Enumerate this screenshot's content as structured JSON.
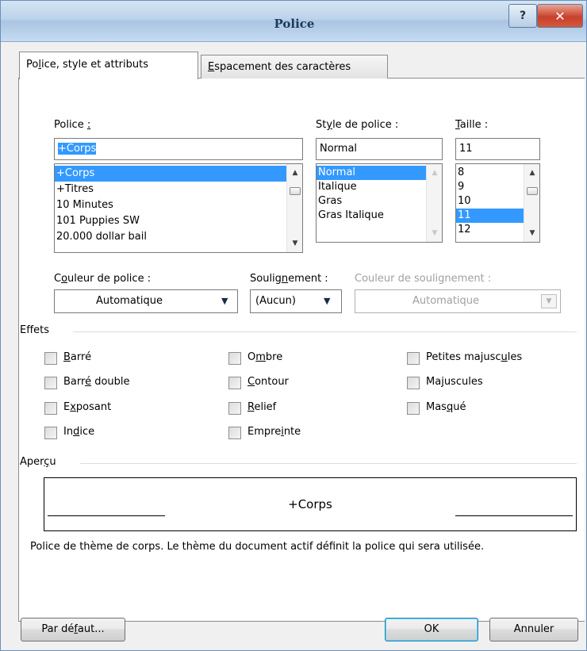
{
  "window": {
    "title": "Police"
  },
  "titlebar": {
    "help_glyph": "?",
    "close_glyph": "✕"
  },
  "tabs": {
    "active": {
      "before": "Po",
      "key": "l",
      "after": "ice, style et attributs"
    },
    "inactive": {
      "before": "",
      "key": "E",
      "after": "spacement des caractères"
    }
  },
  "font": {
    "label_before": "Police ",
    "label_key": ":",
    "label_after": "",
    "value": "+Corps",
    "items": [
      "+Corps",
      "+Titres",
      "10 Minutes",
      "101 Puppies SW",
      "20.000 dollar bail"
    ],
    "selected_index": 0
  },
  "style": {
    "label_before": "St",
    "label_key": "y",
    "label_after": "le de police :",
    "value": "Normal",
    "items": [
      "Normal",
      "Italique",
      "Gras",
      "Gras Italique"
    ],
    "selected_index": 0
  },
  "size": {
    "label_before": "",
    "label_key": "T",
    "label_after": "aille :",
    "value": "11",
    "items": [
      "8",
      "9",
      "10",
      "11",
      "12"
    ],
    "selected_index": 3
  },
  "color": {
    "label_before": "C",
    "label_key": "o",
    "label_after": "uleur de police :",
    "value": "Automatique"
  },
  "underline": {
    "label_before": "Soulig",
    "label_key": "n",
    "label_after": "ement :",
    "value": "(Aucun)"
  },
  "underline_color": {
    "label": "Couleur de soulignement :",
    "value": "Automatique"
  },
  "effects": {
    "title": "Effets",
    "col1": [
      {
        "before": "",
        "key": "B",
        "after": "arré"
      },
      {
        "before": "Barr",
        "key": "é",
        "after": " double"
      },
      {
        "before": "E",
        "key": "x",
        "after": "posant"
      },
      {
        "before": "In",
        "key": "d",
        "after": "ice"
      }
    ],
    "col2": [
      {
        "before": "O",
        "key": "m",
        "after": "bre"
      },
      {
        "before": "",
        "key": "C",
        "after": "ontour"
      },
      {
        "before": "",
        "key": "R",
        "after": "elief"
      },
      {
        "before": "Empre",
        "key": "i",
        "after": "nte"
      }
    ],
    "col3": [
      {
        "before": "Petites majusc",
        "key": "u",
        "after": "les"
      },
      {
        "before": "Ma",
        "key": "j",
        "after": "uscules"
      },
      {
        "before": "Mas",
        "key": "q",
        "after": "ué"
      }
    ]
  },
  "preview": {
    "title_before": "Aper",
    "title_key": "ç",
    "title_after": "u",
    "text": "+Corps",
    "description": "Police de thème de corps. Le thème du document actif définit la police qui sera utilisée."
  },
  "buttons": {
    "default": {
      "before": "Par dé",
      "key": "f",
      "after": "aut..."
    },
    "ok": "OK",
    "cancel": "Annuler"
  }
}
